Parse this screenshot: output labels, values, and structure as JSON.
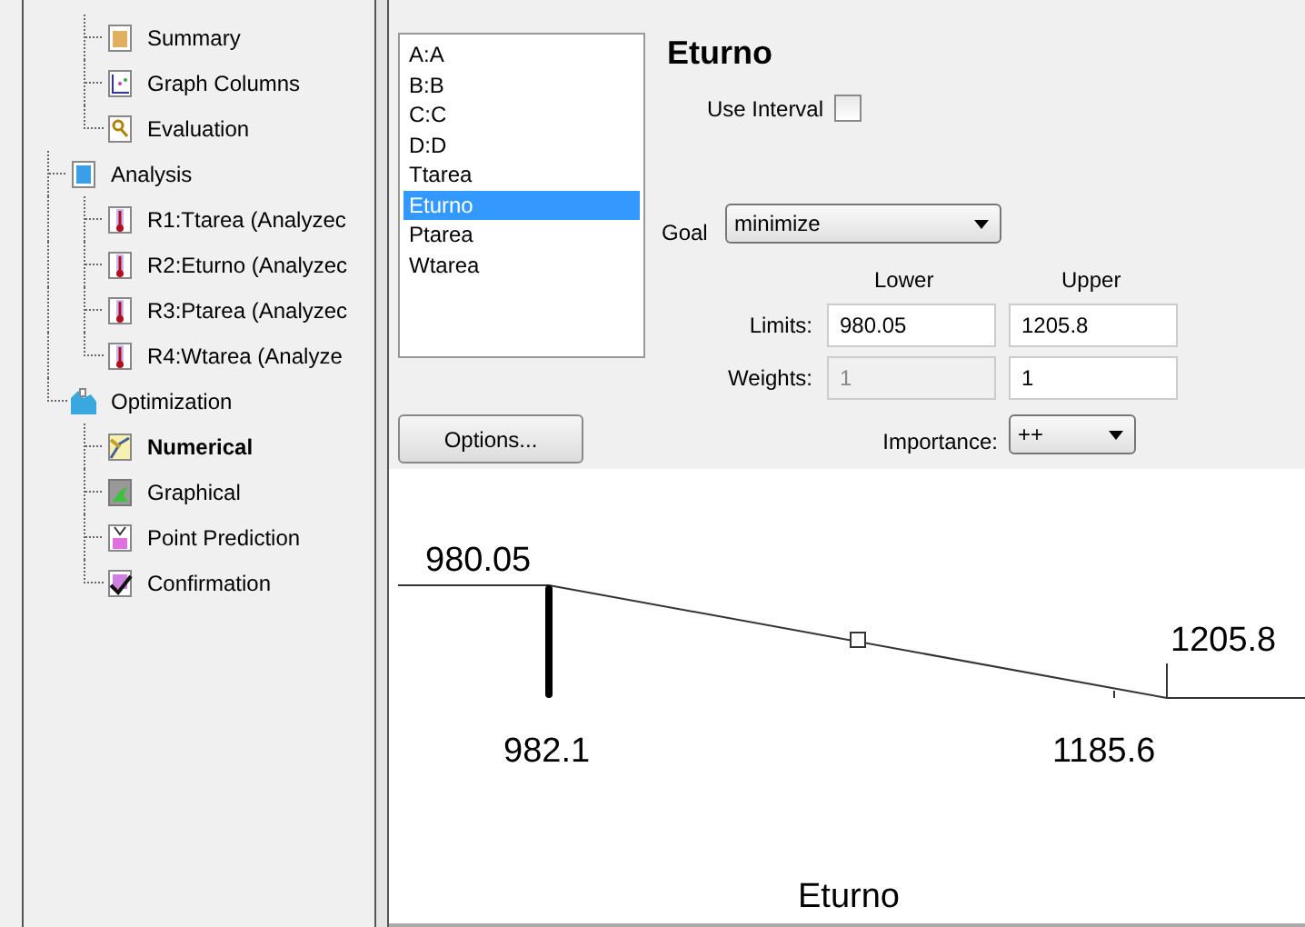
{
  "tree": {
    "items": [
      {
        "kind": "group",
        "children": [
          {
            "kind": "summary",
            "label": "Summary",
            "selected": false
          },
          {
            "kind": "graph",
            "label": "Graph Columns",
            "selected": false
          },
          {
            "kind": "evaluation",
            "label": "Evaluation",
            "selected": false
          }
        ]
      },
      {
        "kind": "analysis",
        "label": "Analysis",
        "selected": false,
        "children": [
          {
            "kind": "response",
            "label": "R1:Ttarea (Analyzec",
            "selected": false
          },
          {
            "kind": "response",
            "label": "R2:Eturno (Analyzec",
            "selected": false
          },
          {
            "kind": "response",
            "label": "R3:Ptarea (Analyzec",
            "selected": false
          },
          {
            "kind": "response",
            "label": "R4:Wtarea (Analyze",
            "selected": false
          }
        ]
      },
      {
        "kind": "optimization",
        "label": "Optimization",
        "selected": false,
        "children": [
          {
            "kind": "numerical",
            "label": "Numerical",
            "selected": true
          },
          {
            "kind": "graphical",
            "label": "Graphical",
            "selected": false
          },
          {
            "kind": "prediction",
            "label": "Point Prediction",
            "selected": false
          },
          {
            "kind": "confirmation",
            "label": "Confirmation",
            "selected": false
          }
        ]
      }
    ]
  },
  "variables": [
    {
      "label": "A:A",
      "selected": false
    },
    {
      "label": "B:B",
      "selected": false
    },
    {
      "label": "C:C",
      "selected": false
    },
    {
      "label": "D:D",
      "selected": false
    },
    {
      "label": "Ttarea",
      "selected": false
    },
    {
      "label": "Eturno",
      "selected": true
    },
    {
      "label": "Ptarea",
      "selected": false
    },
    {
      "label": "Wtarea",
      "selected": false
    }
  ],
  "options_button": "Options...",
  "criteria": {
    "title": "Eturno",
    "use_interval": {
      "label": "Use Interval",
      "checked": false
    },
    "goal": {
      "label": "Goal",
      "value": "minimize"
    },
    "lower_header": "Lower",
    "upper_header": "Upper",
    "limits": {
      "label": "Limits:",
      "lower": "980.05",
      "upper": "1205.8"
    },
    "weights": {
      "label": "Weights:",
      "lower": "1",
      "lower_disabled": true,
      "upper": "1"
    },
    "importance": {
      "label": "Importance:",
      "value": "++"
    }
  },
  "ramp": {
    "lower_label": "980.05",
    "upper_label": "1205.8",
    "markers": [
      {
        "label": "982.1"
      },
      {
        "label": "1185.6"
      }
    ],
    "axis_title": "Eturno"
  }
}
